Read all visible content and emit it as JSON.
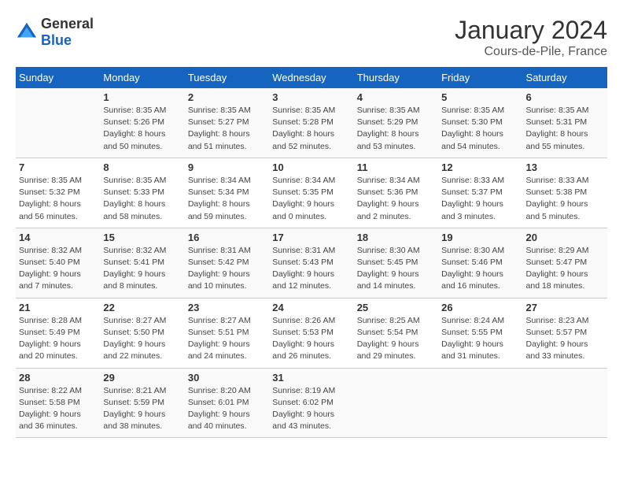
{
  "logo": {
    "general": "General",
    "blue": "Blue"
  },
  "title": "January 2024",
  "subtitle": "Cours-de-Pile, France",
  "weekdays": [
    "Sunday",
    "Monday",
    "Tuesday",
    "Wednesday",
    "Thursday",
    "Friday",
    "Saturday"
  ],
  "weeks": [
    [
      {
        "day": "",
        "info": ""
      },
      {
        "day": "1",
        "info": "Sunrise: 8:35 AM\nSunset: 5:26 PM\nDaylight: 8 hours\nand 50 minutes."
      },
      {
        "day": "2",
        "info": "Sunrise: 8:35 AM\nSunset: 5:27 PM\nDaylight: 8 hours\nand 51 minutes."
      },
      {
        "day": "3",
        "info": "Sunrise: 8:35 AM\nSunset: 5:28 PM\nDaylight: 8 hours\nand 52 minutes."
      },
      {
        "day": "4",
        "info": "Sunrise: 8:35 AM\nSunset: 5:29 PM\nDaylight: 8 hours\nand 53 minutes."
      },
      {
        "day": "5",
        "info": "Sunrise: 8:35 AM\nSunset: 5:30 PM\nDaylight: 8 hours\nand 54 minutes."
      },
      {
        "day": "6",
        "info": "Sunrise: 8:35 AM\nSunset: 5:31 PM\nDaylight: 8 hours\nand 55 minutes."
      }
    ],
    [
      {
        "day": "7",
        "info": "Sunrise: 8:35 AM\nSunset: 5:32 PM\nDaylight: 8 hours\nand 56 minutes."
      },
      {
        "day": "8",
        "info": "Sunrise: 8:35 AM\nSunset: 5:33 PM\nDaylight: 8 hours\nand 58 minutes."
      },
      {
        "day": "9",
        "info": "Sunrise: 8:34 AM\nSunset: 5:34 PM\nDaylight: 8 hours\nand 59 minutes."
      },
      {
        "day": "10",
        "info": "Sunrise: 8:34 AM\nSunset: 5:35 PM\nDaylight: 9 hours\nand 0 minutes."
      },
      {
        "day": "11",
        "info": "Sunrise: 8:34 AM\nSunset: 5:36 PM\nDaylight: 9 hours\nand 2 minutes."
      },
      {
        "day": "12",
        "info": "Sunrise: 8:33 AM\nSunset: 5:37 PM\nDaylight: 9 hours\nand 3 minutes."
      },
      {
        "day": "13",
        "info": "Sunrise: 8:33 AM\nSunset: 5:38 PM\nDaylight: 9 hours\nand 5 minutes."
      }
    ],
    [
      {
        "day": "14",
        "info": "Sunrise: 8:32 AM\nSunset: 5:40 PM\nDaylight: 9 hours\nand 7 minutes."
      },
      {
        "day": "15",
        "info": "Sunrise: 8:32 AM\nSunset: 5:41 PM\nDaylight: 9 hours\nand 8 minutes."
      },
      {
        "day": "16",
        "info": "Sunrise: 8:31 AM\nSunset: 5:42 PM\nDaylight: 9 hours\nand 10 minutes."
      },
      {
        "day": "17",
        "info": "Sunrise: 8:31 AM\nSunset: 5:43 PM\nDaylight: 9 hours\nand 12 minutes."
      },
      {
        "day": "18",
        "info": "Sunrise: 8:30 AM\nSunset: 5:45 PM\nDaylight: 9 hours\nand 14 minutes."
      },
      {
        "day": "19",
        "info": "Sunrise: 8:30 AM\nSunset: 5:46 PM\nDaylight: 9 hours\nand 16 minutes."
      },
      {
        "day": "20",
        "info": "Sunrise: 8:29 AM\nSunset: 5:47 PM\nDaylight: 9 hours\nand 18 minutes."
      }
    ],
    [
      {
        "day": "21",
        "info": "Sunrise: 8:28 AM\nSunset: 5:49 PM\nDaylight: 9 hours\nand 20 minutes."
      },
      {
        "day": "22",
        "info": "Sunrise: 8:27 AM\nSunset: 5:50 PM\nDaylight: 9 hours\nand 22 minutes."
      },
      {
        "day": "23",
        "info": "Sunrise: 8:27 AM\nSunset: 5:51 PM\nDaylight: 9 hours\nand 24 minutes."
      },
      {
        "day": "24",
        "info": "Sunrise: 8:26 AM\nSunset: 5:53 PM\nDaylight: 9 hours\nand 26 minutes."
      },
      {
        "day": "25",
        "info": "Sunrise: 8:25 AM\nSunset: 5:54 PM\nDaylight: 9 hours\nand 29 minutes."
      },
      {
        "day": "26",
        "info": "Sunrise: 8:24 AM\nSunset: 5:55 PM\nDaylight: 9 hours\nand 31 minutes."
      },
      {
        "day": "27",
        "info": "Sunrise: 8:23 AM\nSunset: 5:57 PM\nDaylight: 9 hours\nand 33 minutes."
      }
    ],
    [
      {
        "day": "28",
        "info": "Sunrise: 8:22 AM\nSunset: 5:58 PM\nDaylight: 9 hours\nand 36 minutes."
      },
      {
        "day": "29",
        "info": "Sunrise: 8:21 AM\nSunset: 5:59 PM\nDaylight: 9 hours\nand 38 minutes."
      },
      {
        "day": "30",
        "info": "Sunrise: 8:20 AM\nSunset: 6:01 PM\nDaylight: 9 hours\nand 40 minutes."
      },
      {
        "day": "31",
        "info": "Sunrise: 8:19 AM\nSunset: 6:02 PM\nDaylight: 9 hours\nand 43 minutes."
      },
      {
        "day": "",
        "info": ""
      },
      {
        "day": "",
        "info": ""
      },
      {
        "day": "",
        "info": ""
      }
    ]
  ]
}
